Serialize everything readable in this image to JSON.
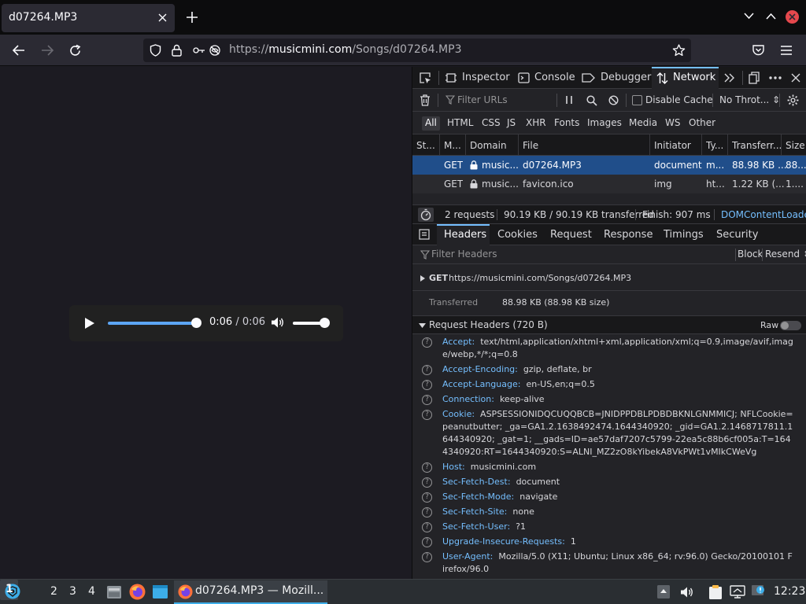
{
  "tab": {
    "title": "d07264.MP3"
  },
  "urlbar": {
    "prefix": "https://",
    "domain": "musicmini.com",
    "path": "/Songs/d07264.MP3"
  },
  "player": {
    "current": "0:06",
    "separator": " / ",
    "duration": "0:06",
    "progress_fraction": 1.0,
    "volume_fraction": 1.0
  },
  "devtools": {
    "tabs": [
      "Inspector",
      "Console",
      "Debugger",
      "Network"
    ],
    "active_tab": "Network",
    "filter_placeholder": "Filter URLs",
    "disable_cache": "Disable Cache",
    "throttle": "No Throt... ⇕",
    "types": [
      "All",
      "HTML",
      "CSS",
      "JS",
      "XHR",
      "Fonts",
      "Images",
      "Media",
      "WS",
      "Other"
    ],
    "columns": [
      "St...",
      "M...",
      "Domain",
      "File",
      "Initiator",
      "Ty...",
      "Transferr...",
      "Size"
    ],
    "requests": [
      {
        "method": "GET",
        "domain": "music...",
        "file": "d07264.MP3",
        "initiator": "document",
        "type": "m...",
        "transferred": "88.98 KB ...",
        "size": "88..."
      },
      {
        "method": "GET",
        "domain": "music...",
        "file": "favicon.ico",
        "initiator": "img",
        "type": "ht...",
        "transferred": "1.22 KB (...",
        "size": "1...."
      }
    ],
    "status": {
      "requests": "2 requests",
      "transferred": "90.19 KB / 90.19 KB transferred",
      "finish": "Finish: 907 ms",
      "domcontent": "DOMContentLoaded:"
    },
    "side_tabs": [
      "Headers",
      "Cookies",
      "Request",
      "Response",
      "Timings",
      "Security"
    ],
    "active_side_tab": "Headers",
    "headers_filter_placeholder": "Filter Headers",
    "block": "Block",
    "resend": "Resend ⇕",
    "summary": {
      "method": "GET",
      "url": "https://musicmini.com/Songs/d07264.MP3",
      "transferred_label": "Transferred",
      "transferred_value": "88.98 KB (88.98 KB size)"
    },
    "request_headers_title": "Request Headers (720 B)",
    "raw_label": "Raw",
    "headers": [
      {
        "name": "Accept:",
        "value": "text/html,application/xhtml+xml,application/xml;q=0.9,image/avif,image/webp,*/*;q=0.8"
      },
      {
        "name": "Accept-Encoding:",
        "value": "gzip, deflate, br"
      },
      {
        "name": "Accept-Language:",
        "value": "en-US,en;q=0.5"
      },
      {
        "name": "Connection:",
        "value": "keep-alive"
      },
      {
        "name": "Cookie:",
        "value": "ASPSESSIONIDQCUQQBCB=JNIDPPDBLPDBDBKNLGNMMICJ; NFLCookie=peanutbutter; _ga=GA1.2.1638492474.1644340920; _gid=GA1.2.1468717811.1644340920; _gat=1; __gads=ID=ae57daf7207c5799-22ea5c88b6cf005a:T=1644340920:RT=1644340920:S=ALNI_MZ2zO8kYibekA8VkPWt1vMIkCWeVg"
      },
      {
        "name": "Host:",
        "value": "musicmini.com"
      },
      {
        "name": "Sec-Fetch-Dest:",
        "value": "document"
      },
      {
        "name": "Sec-Fetch-Mode:",
        "value": "navigate"
      },
      {
        "name": "Sec-Fetch-Site:",
        "value": "none"
      },
      {
        "name": "Sec-Fetch-User:",
        "value": "?1"
      },
      {
        "name": "Upgrade-Insecure-Requests:",
        "value": "1"
      },
      {
        "name": "User-Agent:",
        "value": "Mozilla/5.0 (X11; Ubuntu; Linux x86_64; rv:96.0) Gecko/20100101 Firefox/96.0"
      }
    ]
  },
  "taskbar": {
    "workspaces": [
      "1",
      "2",
      "3",
      "4"
    ],
    "window_title": "d07264.MP3 — Mozill...",
    "clock": "12:23"
  },
  "colors": {
    "accent": "#75bfff",
    "selected_row": "#204e8a",
    "seek": "#5da6f5",
    "close_button": "#e5484d"
  }
}
